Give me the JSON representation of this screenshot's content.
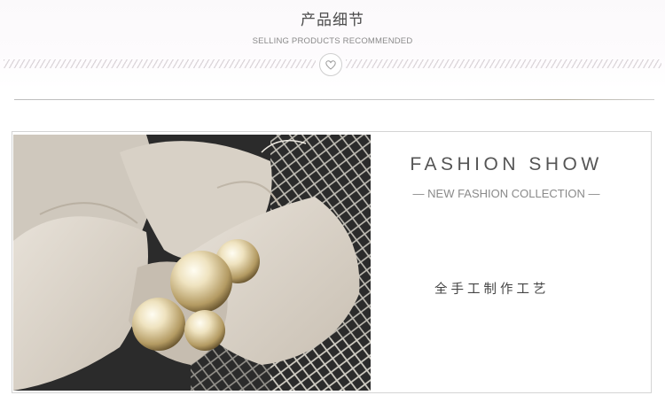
{
  "header": {
    "title": "产品细节",
    "subtitle": "SELLING PRODUCTS RECOMMENDED",
    "icon": "heart-icon"
  },
  "feature": {
    "heading": "FASHION SHOW",
    "subheading": "NEW FASHION COLLECTION",
    "dash": "—",
    "craft_text": "全手工制作工艺",
    "image_icon": "bow-pearl-hat-photo"
  },
  "colors": {
    "felt": "#d8d0c6",
    "background_dark": "#2a2a2a",
    "pearl": "#e8dcb8",
    "text_dark": "#555555",
    "text_light": "#8a8a8a"
  }
}
